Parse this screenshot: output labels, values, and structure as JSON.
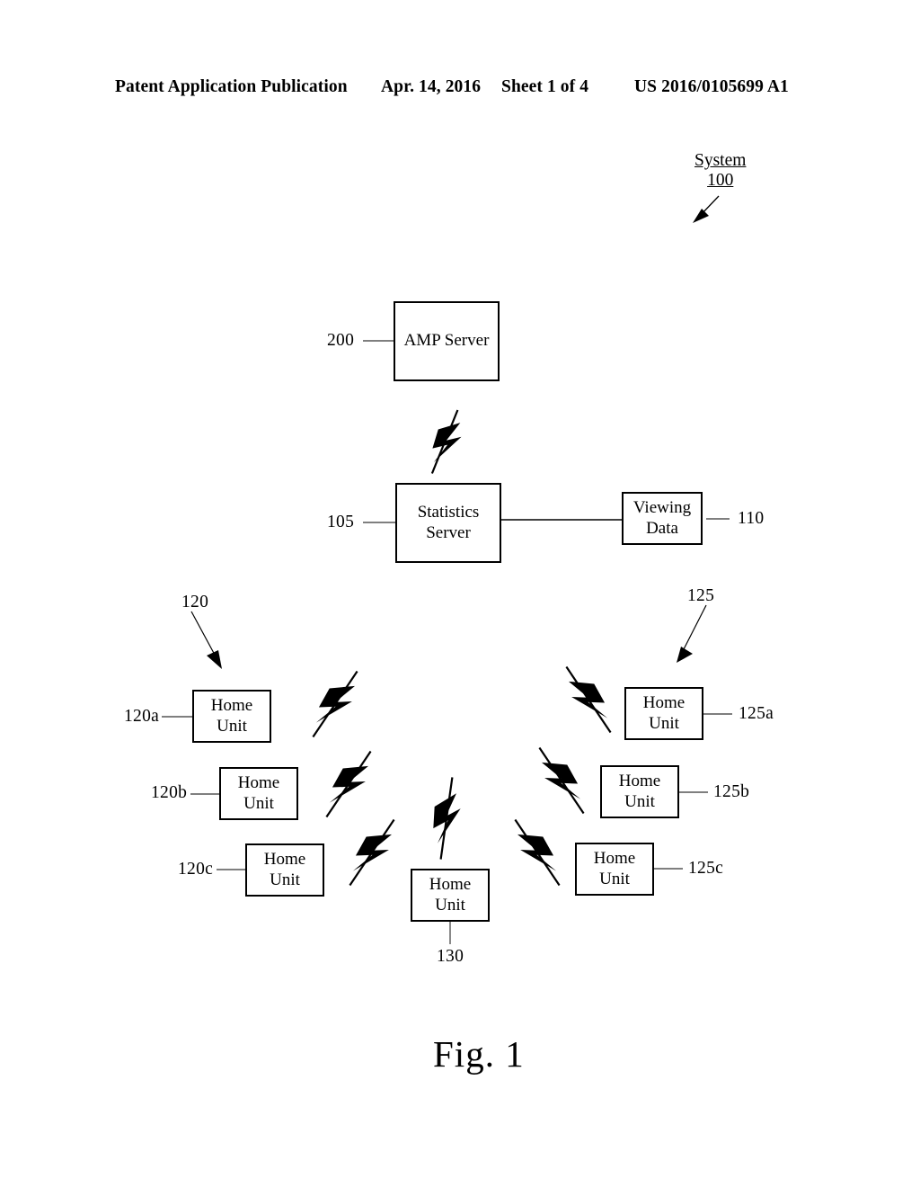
{
  "header": {
    "publication": "Patent Application Publication",
    "date": "Apr. 14, 2016",
    "sheet": "Sheet 1 of 4",
    "patent_number": "US 2016/0105699 A1"
  },
  "figure": {
    "caption": "Fig. 1",
    "system_label": {
      "name": "System",
      "number": "100"
    },
    "nodes": [
      {
        "id": "amp-server",
        "ref": "200",
        "line1": "AMP Server",
        "line2": ""
      },
      {
        "id": "statistics-server",
        "ref": "105",
        "line1": "Statistics",
        "line2": "Server"
      },
      {
        "id": "viewing-data",
        "ref": "110",
        "line1": "Viewing",
        "line2": "Data"
      },
      {
        "id": "home-unit-120a",
        "ref": "120a",
        "line1": "Home",
        "line2": "Unit"
      },
      {
        "id": "home-unit-120b",
        "ref": "120b",
        "line1": "Home",
        "line2": "Unit"
      },
      {
        "id": "home-unit-120c",
        "ref": "120c",
        "line1": "Home",
        "line2": "Unit"
      },
      {
        "id": "home-unit-125a",
        "ref": "125a",
        "line1": "Home",
        "line2": "Unit"
      },
      {
        "id": "home-unit-125b",
        "ref": "125b",
        "line1": "Home",
        "line2": "Unit"
      },
      {
        "id": "home-unit-125c",
        "ref": "125c",
        "line1": "Home",
        "line2": "Unit"
      },
      {
        "id": "home-unit-130",
        "ref": "130",
        "line1": "Home",
        "line2": "Unit"
      }
    ],
    "group_labels": [
      {
        "id": "group-120",
        "ref": "120"
      },
      {
        "id": "group-125",
        "ref": "125"
      }
    ],
    "colors": {
      "ink": "#000000",
      "paper": "#ffffff",
      "leader": "#555555"
    }
  }
}
